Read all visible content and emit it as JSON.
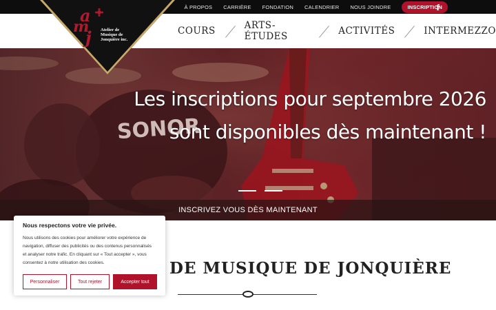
{
  "topnav": {
    "links": [
      "À PROPOS",
      "CARRIÈRE",
      "FONDATION",
      "CALENDRIER",
      "NOUS JOINDRE"
    ],
    "cta": "INSCRIPTION",
    "social_icon": "facebook-icon",
    "social_glyph": "f"
  },
  "logo": {
    "letters": [
      "a",
      "m",
      "j"
    ],
    "text_lines": [
      "Atelier de",
      "Musique de",
      "Jonquière inc."
    ]
  },
  "mainnav": {
    "items": [
      "COURS",
      "ARTS-ÉTUDES",
      "ACTIVITÉS",
      "INTERMEZZO"
    ]
  },
  "hero": {
    "line1": "Les inscriptions pour septembre 2026",
    "line2": "sont disponibles dès maintenant !",
    "drum_text": "SONOR",
    "slides": 2,
    "cta": "INSCRIVEZ VOUS DÈS MAINTENANT"
  },
  "section": {
    "title": "DE MUSIQUE DE JONQUIÈRE"
  },
  "cookie": {
    "title": "Nous respectons votre vie privée.",
    "body": "Nous utilisons des cookies pour améliorer votre expérience de navigation, diffuser des publicités ou des contenus personnalisés et analyser notre trafic. En cliquant sur « Tout accepter », vous consentez à notre utilisation des cookies.",
    "btn_customize": "Personnaliser",
    "btn_reject": "Tout rejeter",
    "btn_accept": "Accepter tout"
  },
  "colors": {
    "accent": "#b0122b",
    "topbar": "#0d0d0d"
  }
}
